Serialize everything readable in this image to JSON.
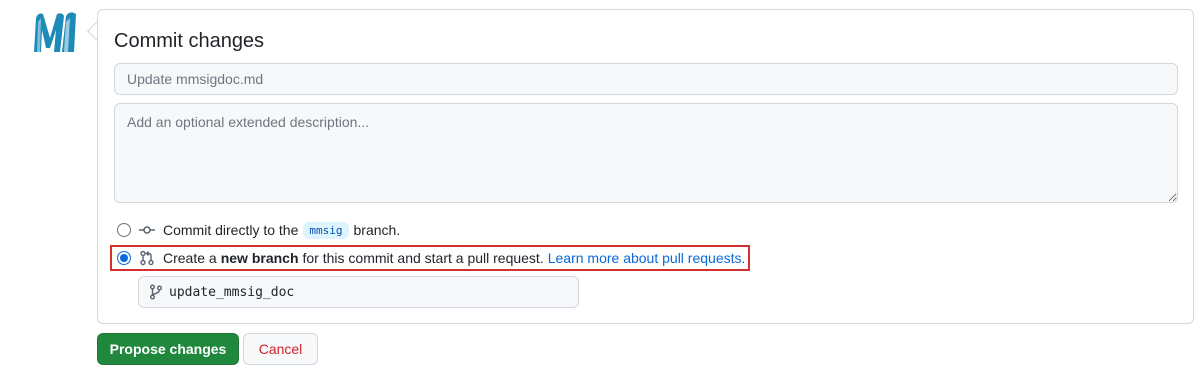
{
  "avatar": {
    "icon": "m-logo-icon",
    "color": "#1e8ab8"
  },
  "commit_form": {
    "title": "Commit changes",
    "summary_placeholder": "Update mmsigdoc.md",
    "summary_value": "",
    "description_placeholder": "Add an optional extended description...",
    "description_value": "",
    "options": {
      "direct": {
        "selected": false,
        "icon": "git-commit-icon",
        "prefix": "Commit directly to the",
        "branch_chip": "mmsig",
        "suffix": "branch."
      },
      "new_branch": {
        "selected": true,
        "icon": "git-pull-request-icon",
        "prefix": "Create a",
        "bold": "new branch",
        "suffix": "for this commit and start a pull request.",
        "link": "Learn more about pull requests."
      }
    },
    "branch_name": {
      "icon": "git-branch-icon",
      "value": "update_mmsig_doc"
    }
  },
  "actions": {
    "propose_label": "Propose changes",
    "cancel_label": "Cancel"
  },
  "colors": {
    "primary": "#1f883d",
    "danger": "#cf222e",
    "link": "#0969da",
    "highlight_border": "#d32f2f"
  }
}
